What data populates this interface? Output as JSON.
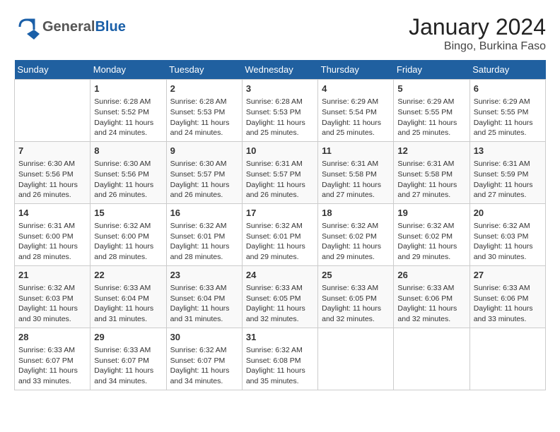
{
  "header": {
    "logo_general": "General",
    "logo_blue": "Blue",
    "title": "January 2024",
    "subtitle": "Bingo, Burkina Faso"
  },
  "days_of_week": [
    "Sunday",
    "Monday",
    "Tuesday",
    "Wednesday",
    "Thursday",
    "Friday",
    "Saturday"
  ],
  "weeks": [
    [
      {
        "num": "",
        "info": ""
      },
      {
        "num": "1",
        "info": "Sunrise: 6:28 AM\nSunset: 5:52 PM\nDaylight: 11 hours and 24 minutes."
      },
      {
        "num": "2",
        "info": "Sunrise: 6:28 AM\nSunset: 5:53 PM\nDaylight: 11 hours and 24 minutes."
      },
      {
        "num": "3",
        "info": "Sunrise: 6:28 AM\nSunset: 5:53 PM\nDaylight: 11 hours and 25 minutes."
      },
      {
        "num": "4",
        "info": "Sunrise: 6:29 AM\nSunset: 5:54 PM\nDaylight: 11 hours and 25 minutes."
      },
      {
        "num": "5",
        "info": "Sunrise: 6:29 AM\nSunset: 5:55 PM\nDaylight: 11 hours and 25 minutes."
      },
      {
        "num": "6",
        "info": "Sunrise: 6:29 AM\nSunset: 5:55 PM\nDaylight: 11 hours and 25 minutes."
      }
    ],
    [
      {
        "num": "7",
        "info": "Sunrise: 6:30 AM\nSunset: 5:56 PM\nDaylight: 11 hours and 26 minutes."
      },
      {
        "num": "8",
        "info": "Sunrise: 6:30 AM\nSunset: 5:56 PM\nDaylight: 11 hours and 26 minutes."
      },
      {
        "num": "9",
        "info": "Sunrise: 6:30 AM\nSunset: 5:57 PM\nDaylight: 11 hours and 26 minutes."
      },
      {
        "num": "10",
        "info": "Sunrise: 6:31 AM\nSunset: 5:57 PM\nDaylight: 11 hours and 26 minutes."
      },
      {
        "num": "11",
        "info": "Sunrise: 6:31 AM\nSunset: 5:58 PM\nDaylight: 11 hours and 27 minutes."
      },
      {
        "num": "12",
        "info": "Sunrise: 6:31 AM\nSunset: 5:58 PM\nDaylight: 11 hours and 27 minutes."
      },
      {
        "num": "13",
        "info": "Sunrise: 6:31 AM\nSunset: 5:59 PM\nDaylight: 11 hours and 27 minutes."
      }
    ],
    [
      {
        "num": "14",
        "info": "Sunrise: 6:31 AM\nSunset: 6:00 PM\nDaylight: 11 hours and 28 minutes."
      },
      {
        "num": "15",
        "info": "Sunrise: 6:32 AM\nSunset: 6:00 PM\nDaylight: 11 hours and 28 minutes."
      },
      {
        "num": "16",
        "info": "Sunrise: 6:32 AM\nSunset: 6:01 PM\nDaylight: 11 hours and 28 minutes."
      },
      {
        "num": "17",
        "info": "Sunrise: 6:32 AM\nSunset: 6:01 PM\nDaylight: 11 hours and 29 minutes."
      },
      {
        "num": "18",
        "info": "Sunrise: 6:32 AM\nSunset: 6:02 PM\nDaylight: 11 hours and 29 minutes."
      },
      {
        "num": "19",
        "info": "Sunrise: 6:32 AM\nSunset: 6:02 PM\nDaylight: 11 hours and 29 minutes."
      },
      {
        "num": "20",
        "info": "Sunrise: 6:32 AM\nSunset: 6:03 PM\nDaylight: 11 hours and 30 minutes."
      }
    ],
    [
      {
        "num": "21",
        "info": "Sunrise: 6:32 AM\nSunset: 6:03 PM\nDaylight: 11 hours and 30 minutes."
      },
      {
        "num": "22",
        "info": "Sunrise: 6:33 AM\nSunset: 6:04 PM\nDaylight: 11 hours and 31 minutes."
      },
      {
        "num": "23",
        "info": "Sunrise: 6:33 AM\nSunset: 6:04 PM\nDaylight: 11 hours and 31 minutes."
      },
      {
        "num": "24",
        "info": "Sunrise: 6:33 AM\nSunset: 6:05 PM\nDaylight: 11 hours and 32 minutes."
      },
      {
        "num": "25",
        "info": "Sunrise: 6:33 AM\nSunset: 6:05 PM\nDaylight: 11 hours and 32 minutes."
      },
      {
        "num": "26",
        "info": "Sunrise: 6:33 AM\nSunset: 6:06 PM\nDaylight: 11 hours and 32 minutes."
      },
      {
        "num": "27",
        "info": "Sunrise: 6:33 AM\nSunset: 6:06 PM\nDaylight: 11 hours and 33 minutes."
      }
    ],
    [
      {
        "num": "28",
        "info": "Sunrise: 6:33 AM\nSunset: 6:07 PM\nDaylight: 11 hours and 33 minutes."
      },
      {
        "num": "29",
        "info": "Sunrise: 6:33 AM\nSunset: 6:07 PM\nDaylight: 11 hours and 34 minutes."
      },
      {
        "num": "30",
        "info": "Sunrise: 6:32 AM\nSunset: 6:07 PM\nDaylight: 11 hours and 34 minutes."
      },
      {
        "num": "31",
        "info": "Sunrise: 6:32 AM\nSunset: 6:08 PM\nDaylight: 11 hours and 35 minutes."
      },
      {
        "num": "",
        "info": ""
      },
      {
        "num": "",
        "info": ""
      },
      {
        "num": "",
        "info": ""
      }
    ]
  ]
}
